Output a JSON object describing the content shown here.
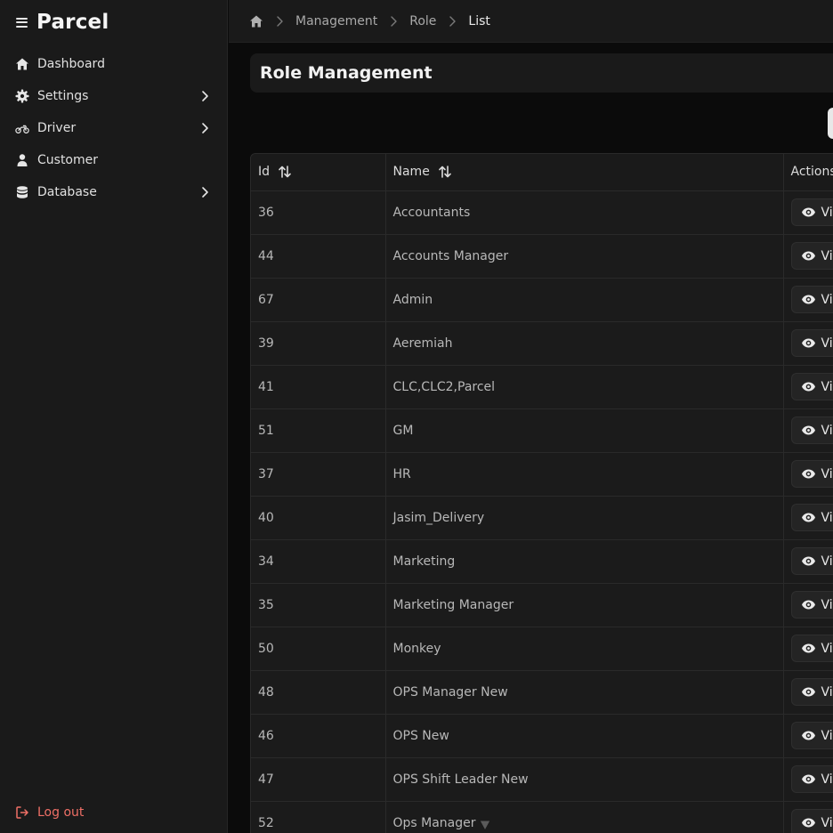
{
  "app": {
    "name": "Parcel"
  },
  "sidebar": {
    "items": [
      {
        "label": "Dashboard",
        "icon": "home-icon",
        "has_children": false
      },
      {
        "label": "Settings",
        "icon": "gear-icon",
        "has_children": true
      },
      {
        "label": "Driver",
        "icon": "motorbike-icon",
        "has_children": true
      },
      {
        "label": "Customer",
        "icon": "user-icon",
        "has_children": false
      },
      {
        "label": "Database",
        "icon": "database-icon",
        "has_children": true
      }
    ],
    "logout_label": "Log out"
  },
  "breadcrumb": {
    "home_icon": "home-icon",
    "items": [
      "Management",
      "Role",
      "List"
    ]
  },
  "page": {
    "title": "Role Management"
  },
  "table": {
    "columns": [
      "Id",
      "Name",
      "Actions"
    ],
    "view_label": "View",
    "rows": [
      {
        "id": "36",
        "name": "Accountants"
      },
      {
        "id": "44",
        "name": "Accounts Manager"
      },
      {
        "id": "67",
        "name": "Admin"
      },
      {
        "id": "39",
        "name": "Aeremiah"
      },
      {
        "id": "41",
        "name": "CLC,CLC2,Parcel"
      },
      {
        "id": "51",
        "name": "GM"
      },
      {
        "id": "37",
        "name": "HR"
      },
      {
        "id": "40",
        "name": "Jasim_Delivery"
      },
      {
        "id": "34",
        "name": "Marketing"
      },
      {
        "id": "35",
        "name": "Marketing Manager"
      },
      {
        "id": "50",
        "name": "Monkey"
      },
      {
        "id": "48",
        "name": "OPS Manager New"
      },
      {
        "id": "46",
        "name": "OPS New"
      },
      {
        "id": "47",
        "name": "OPS Shift Leader New"
      },
      {
        "id": "52",
        "name": "Ops Manager"
      }
    ]
  },
  "colors": {
    "sidebar_bg": "#1a1a1a",
    "page_bg": "#0b0b0b",
    "logout": "#ef6f66",
    "text": "#e6e6e6",
    "muted": "#b8b8b8"
  }
}
